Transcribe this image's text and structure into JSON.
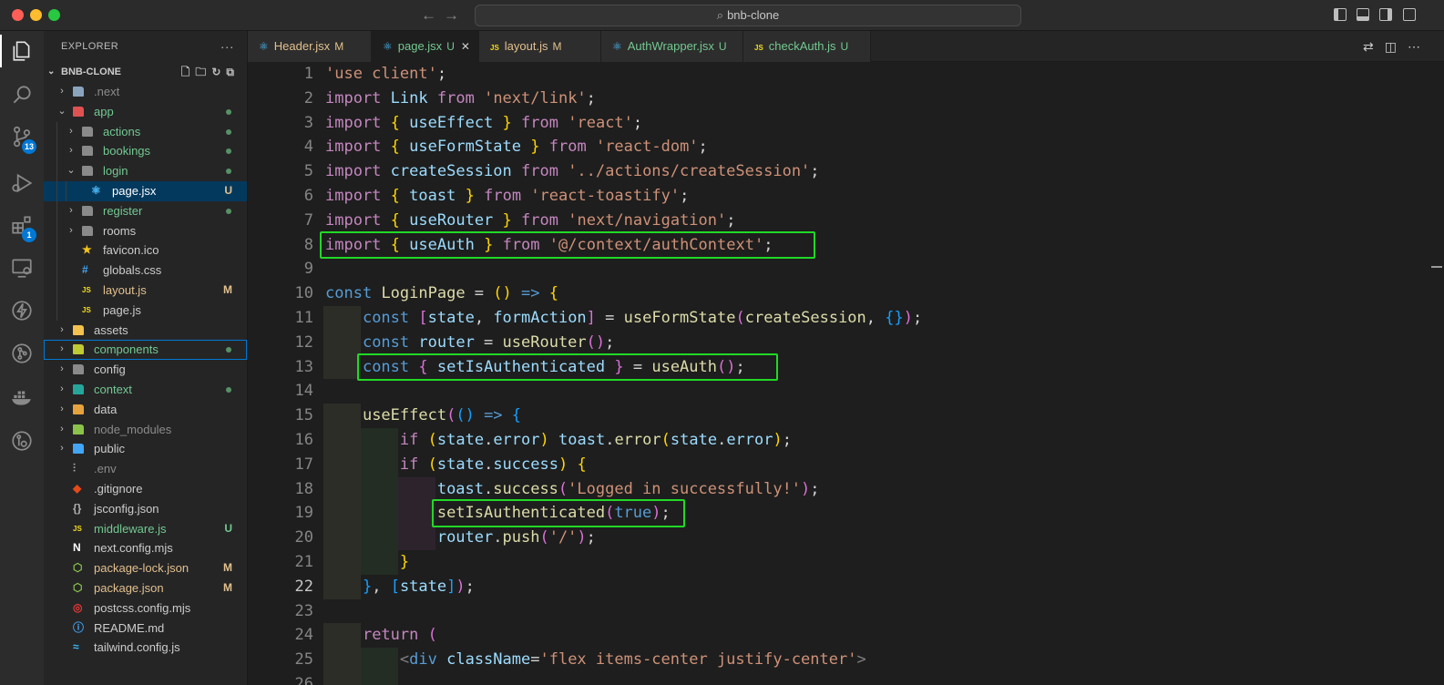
{
  "window": {
    "search_text": "bnb-clone"
  },
  "activity_bar": {
    "source_control_badge": "13",
    "extensions_badge": "1"
  },
  "explorer": {
    "title": "EXPLORER",
    "more": "···",
    "root": "BNB-CLONE",
    "items": [
      {
        "label": ".next",
        "kind": "folder",
        "depth": 1,
        "expanded": false,
        "color": "#8b8b8b",
        "icon_color": "#8aa4bd",
        "status": ""
      },
      {
        "label": "app",
        "kind": "folder",
        "depth": 1,
        "expanded": true,
        "color": "#73c991",
        "icon_color": "#e05252",
        "status": "dot"
      },
      {
        "label": "actions",
        "kind": "folder",
        "depth": 2,
        "expanded": false,
        "color": "#73c991",
        "icon_color": "#8a8a8a",
        "status": "dot"
      },
      {
        "label": "bookings",
        "kind": "folder",
        "depth": 2,
        "expanded": false,
        "color": "#73c991",
        "icon_color": "#8a8a8a",
        "status": "dot"
      },
      {
        "label": "login",
        "kind": "folder",
        "depth": 2,
        "expanded": true,
        "color": "#73c991",
        "icon_color": "#8a8a8a",
        "status": "dot"
      },
      {
        "label": "page.jsx",
        "kind": "file",
        "depth": 3,
        "color": "#ffffff",
        "icon_color": "#4fc1ff",
        "icon": "react-icon",
        "status": "U",
        "status_color": "#e2c08d",
        "selected": true
      },
      {
        "label": "register",
        "kind": "folder",
        "depth": 2,
        "expanded": false,
        "color": "#73c991",
        "icon_color": "#8a8a8a",
        "status": "dot"
      },
      {
        "label": "rooms",
        "kind": "folder",
        "depth": 2,
        "expanded": false,
        "color": "#cccccc",
        "icon_color": "#8a8a8a",
        "status": ""
      },
      {
        "label": "favicon.ico",
        "kind": "file",
        "depth": 2,
        "color": "#cccccc",
        "icon_color": "#f5c518",
        "icon": "star-icon",
        "status": ""
      },
      {
        "label": "globals.css",
        "kind": "file",
        "depth": 2,
        "color": "#cccccc",
        "icon_color": "#42a5f5",
        "icon": "css-icon",
        "status": ""
      },
      {
        "label": "layout.js",
        "kind": "file",
        "depth": 2,
        "color": "#e2c08d",
        "icon_color": "#f5de19",
        "icon": "js-icon",
        "status": "M",
        "status_color": "#e2c08d"
      },
      {
        "label": "page.js",
        "kind": "file",
        "depth": 2,
        "color": "#cccccc",
        "icon_color": "#f5de19",
        "icon": "js-icon",
        "status": ""
      },
      {
        "label": "assets",
        "kind": "folder",
        "depth": 1,
        "expanded": false,
        "color": "#cccccc",
        "icon_color": "#f2c14e",
        "status": ""
      },
      {
        "label": "components",
        "kind": "folder",
        "depth": 1,
        "expanded": false,
        "color": "#73c991",
        "icon_color": "#c0ca33",
        "status": "dot",
        "focused": true
      },
      {
        "label": "config",
        "kind": "folder",
        "depth": 1,
        "expanded": false,
        "color": "#cccccc",
        "icon_color": "#8a8a8a",
        "status": ""
      },
      {
        "label": "context",
        "kind": "folder",
        "depth": 1,
        "expanded": false,
        "color": "#73c991",
        "icon_color": "#26a69a",
        "status": "dot"
      },
      {
        "label": "data",
        "kind": "folder",
        "depth": 1,
        "expanded": false,
        "color": "#cccccc",
        "icon_color": "#e6a23c",
        "status": ""
      },
      {
        "label": "node_modules",
        "kind": "folder",
        "depth": 1,
        "expanded": false,
        "color": "#8b8b8b",
        "icon_color": "#8bc34a",
        "status": ""
      },
      {
        "label": "public",
        "kind": "folder",
        "depth": 1,
        "expanded": false,
        "color": "#cccccc",
        "icon_color": "#42a5f5",
        "status": ""
      },
      {
        "label": ".env",
        "kind": "file",
        "depth": 1,
        "color": "#8b8b8b",
        "icon_color": "#b0b0b0",
        "icon": "settings-icon",
        "status": ""
      },
      {
        "label": ".gitignore",
        "kind": "file",
        "depth": 1,
        "color": "#cccccc",
        "icon_color": "#e64a19",
        "icon": "git-icon",
        "status": ""
      },
      {
        "label": "jsconfig.json",
        "kind": "file",
        "depth": 1,
        "color": "#cccccc",
        "icon_color": "#b0b0b0",
        "icon": "json-icon",
        "status": ""
      },
      {
        "label": "middleware.js",
        "kind": "file",
        "depth": 1,
        "color": "#73c991",
        "icon_color": "#f5de19",
        "icon": "js-icon",
        "status": "U",
        "status_color": "#73c991"
      },
      {
        "label": "next.config.mjs",
        "kind": "file",
        "depth": 1,
        "color": "#cccccc",
        "icon_color": "#ffffff",
        "icon": "nextjs-icon",
        "status": ""
      },
      {
        "label": "package-lock.json",
        "kind": "file",
        "depth": 1,
        "color": "#e2c08d",
        "icon_color": "#8bc34a",
        "icon": "nodejs-icon",
        "status": "M",
        "status_color": "#e2c08d"
      },
      {
        "label": "package.json",
        "kind": "file",
        "depth": 1,
        "color": "#e2c08d",
        "icon_color": "#8bc34a",
        "icon": "nodejs-icon",
        "status": "M",
        "status_color": "#e2c08d"
      },
      {
        "label": "postcss.config.mjs",
        "kind": "file",
        "depth": 1,
        "color": "#cccccc",
        "icon_color": "#e53935",
        "icon": "postcss-icon",
        "status": ""
      },
      {
        "label": "README.md",
        "kind": "file",
        "depth": 1,
        "color": "#cccccc",
        "icon_color": "#42a5f5",
        "icon": "info-icon",
        "status": ""
      },
      {
        "label": "tailwind.config.js",
        "kind": "file",
        "depth": 1,
        "color": "#cccccc",
        "icon_color": "#38bdf8",
        "icon": "tailwind-icon",
        "status": ""
      }
    ]
  },
  "tabs": [
    {
      "label": "Header.jsx",
      "state": "M",
      "state_color": "#e2c08d",
      "label_color": "#e2c08d",
      "icon": "react-icon",
      "icon_glyph": "⚛",
      "icon_color": "#4fc1ff",
      "active": false
    },
    {
      "label": "page.jsx",
      "state": "U",
      "state_color": "#73c991",
      "label_color": "#73c991",
      "icon": "react-icon",
      "icon_glyph": "⚛",
      "icon_color": "#4fc1ff",
      "active": true,
      "close": "✕"
    },
    {
      "label": "layout.js",
      "state": "M",
      "state_color": "#e2c08d",
      "label_color": "#e2c08d",
      "icon": "js-icon",
      "icon_glyph": "JS",
      "icon_color": "#f5de19",
      "active": false
    },
    {
      "label": "AuthWrapper.jsx",
      "state": "U",
      "state_color": "#73c991",
      "label_color": "#73c991",
      "icon": "react-icon",
      "icon_glyph": "⚛",
      "icon_color": "#4fc1ff",
      "active": false
    },
    {
      "label": "checkAuth.js",
      "state": "U",
      "state_color": "#73c991",
      "label_color": "#73c991",
      "icon": "js-icon",
      "icon_glyph": "JS",
      "icon_color": "#f5de19",
      "active": false
    }
  ],
  "editor": {
    "current_line": 22,
    "line_numbers": [
      "1",
      "2",
      "3",
      "4",
      "5",
      "6",
      "7",
      "8",
      "9",
      "10",
      "11",
      "12",
      "13",
      "14",
      "15",
      "16",
      "17",
      "18",
      "19",
      "20",
      "21",
      "22",
      "23",
      "24",
      "25",
      "26"
    ],
    "lines": [
      [
        [
          "str",
          "'use client'"
        ],
        [
          "pl",
          ";"
        ]
      ],
      [
        [
          "kw",
          "import"
        ],
        [
          "pl",
          " "
        ],
        [
          "var",
          "Link"
        ],
        [
          "pl",
          " "
        ],
        [
          "kw",
          "from"
        ],
        [
          "pl",
          " "
        ],
        [
          "str",
          "'next/link'"
        ],
        [
          "pl",
          ";"
        ]
      ],
      [
        [
          "kw",
          "import"
        ],
        [
          "pl",
          " "
        ],
        [
          "br1",
          "{"
        ],
        [
          "pl",
          " "
        ],
        [
          "var",
          "useEffect"
        ],
        [
          "pl",
          " "
        ],
        [
          "br1",
          "}"
        ],
        [
          "pl",
          " "
        ],
        [
          "kw",
          "from"
        ],
        [
          "pl",
          " "
        ],
        [
          "str",
          "'react'"
        ],
        [
          "pl",
          ";"
        ]
      ],
      [
        [
          "kw",
          "import"
        ],
        [
          "pl",
          " "
        ],
        [
          "br1",
          "{"
        ],
        [
          "pl",
          " "
        ],
        [
          "var",
          "useFormState"
        ],
        [
          "pl",
          " "
        ],
        [
          "br1",
          "}"
        ],
        [
          "pl",
          " "
        ],
        [
          "kw",
          "from"
        ],
        [
          "pl",
          " "
        ],
        [
          "str",
          "'react-dom'"
        ],
        [
          "pl",
          ";"
        ]
      ],
      [
        [
          "kw",
          "import"
        ],
        [
          "pl",
          " "
        ],
        [
          "var",
          "createSession"
        ],
        [
          "pl",
          " "
        ],
        [
          "kw",
          "from"
        ],
        [
          "pl",
          " "
        ],
        [
          "str",
          "'../actions/createSession'"
        ],
        [
          "pl",
          ";"
        ]
      ],
      [
        [
          "kw",
          "import"
        ],
        [
          "pl",
          " "
        ],
        [
          "br1",
          "{"
        ],
        [
          "pl",
          " "
        ],
        [
          "var",
          "toast"
        ],
        [
          "pl",
          " "
        ],
        [
          "br1",
          "}"
        ],
        [
          "pl",
          " "
        ],
        [
          "kw",
          "from"
        ],
        [
          "pl",
          " "
        ],
        [
          "str",
          "'react-toastify'"
        ],
        [
          "pl",
          ";"
        ]
      ],
      [
        [
          "kw",
          "import"
        ],
        [
          "pl",
          " "
        ],
        [
          "br1",
          "{"
        ],
        [
          "pl",
          " "
        ],
        [
          "var",
          "useRouter"
        ],
        [
          "pl",
          " "
        ],
        [
          "br1",
          "}"
        ],
        [
          "pl",
          " "
        ],
        [
          "kw",
          "from"
        ],
        [
          "pl",
          " "
        ],
        [
          "str",
          "'next/navigation'"
        ],
        [
          "pl",
          ";"
        ]
      ],
      [
        [
          "kw",
          "import"
        ],
        [
          "pl",
          " "
        ],
        [
          "br1",
          "{"
        ],
        [
          "pl",
          " "
        ],
        [
          "var",
          "useAuth"
        ],
        [
          "pl",
          " "
        ],
        [
          "br1",
          "}"
        ],
        [
          "pl",
          " "
        ],
        [
          "kw",
          "from"
        ],
        [
          "pl",
          " "
        ],
        [
          "str",
          "'@/context/authContext'"
        ],
        [
          "pl",
          ";"
        ]
      ],
      [],
      [
        [
          "kb",
          "const"
        ],
        [
          "pl",
          " "
        ],
        [
          "fn",
          "LoginPage"
        ],
        [
          "pl",
          " = "
        ],
        [
          "br1",
          "()"
        ],
        [
          "pl",
          " "
        ],
        [
          "kb",
          "=>"
        ],
        [
          "pl",
          " "
        ],
        [
          "br1",
          "{"
        ]
      ],
      [
        [
          "pl",
          "    "
        ],
        [
          "kb",
          "const"
        ],
        [
          "pl",
          " "
        ],
        [
          "br2",
          "["
        ],
        [
          "var",
          "state"
        ],
        [
          "pl",
          ", "
        ],
        [
          "var",
          "formAction"
        ],
        [
          "br2",
          "]"
        ],
        [
          "pl",
          " = "
        ],
        [
          "fn",
          "useFormState"
        ],
        [
          "br2",
          "("
        ],
        [
          "fn",
          "createSession"
        ],
        [
          "pl",
          ", "
        ],
        [
          "br3",
          "{}"
        ],
        [
          "br2",
          ")"
        ],
        [
          "pl",
          ";"
        ]
      ],
      [
        [
          "pl",
          "    "
        ],
        [
          "kb",
          "const"
        ],
        [
          "pl",
          " "
        ],
        [
          "var",
          "router"
        ],
        [
          "pl",
          " = "
        ],
        [
          "fn",
          "useRouter"
        ],
        [
          "br2",
          "()"
        ],
        [
          "pl",
          ";"
        ]
      ],
      [
        [
          "pl",
          "    "
        ],
        [
          "kb",
          "const"
        ],
        [
          "pl",
          " "
        ],
        [
          "br2",
          "{"
        ],
        [
          "pl",
          " "
        ],
        [
          "var",
          "setIsAuthenticated"
        ],
        [
          "pl",
          " "
        ],
        [
          "br2",
          "}"
        ],
        [
          "pl",
          " = "
        ],
        [
          "fn",
          "useAuth"
        ],
        [
          "br2",
          "()"
        ],
        [
          "pl",
          ";"
        ]
      ],
      [],
      [
        [
          "pl",
          "    "
        ],
        [
          "fn",
          "useEffect"
        ],
        [
          "br2",
          "("
        ],
        [
          "br3",
          "()"
        ],
        [
          "pl",
          " "
        ],
        [
          "kb",
          "=>"
        ],
        [
          "pl",
          " "
        ],
        [
          "br3",
          "{"
        ]
      ],
      [
        [
          "pl",
          "        "
        ],
        [
          "kw",
          "if"
        ],
        [
          "pl",
          " "
        ],
        [
          "br1",
          "("
        ],
        [
          "var",
          "state"
        ],
        [
          "pl",
          "."
        ],
        [
          "var",
          "error"
        ],
        [
          "br1",
          ")"
        ],
        [
          "pl",
          " "
        ],
        [
          "var",
          "toast"
        ],
        [
          "pl",
          "."
        ],
        [
          "fn",
          "error"
        ],
        [
          "br1",
          "("
        ],
        [
          "var",
          "state"
        ],
        [
          "pl",
          "."
        ],
        [
          "var",
          "error"
        ],
        [
          "br1",
          ")"
        ],
        [
          "pl",
          ";"
        ]
      ],
      [
        [
          "pl",
          "        "
        ],
        [
          "kw",
          "if"
        ],
        [
          "pl",
          " "
        ],
        [
          "br1",
          "("
        ],
        [
          "var",
          "state"
        ],
        [
          "pl",
          "."
        ],
        [
          "var",
          "success"
        ],
        [
          "br1",
          ")"
        ],
        [
          "pl",
          " "
        ],
        [
          "br1",
          "{"
        ]
      ],
      [
        [
          "pl",
          "            "
        ],
        [
          "var",
          "toast"
        ],
        [
          "pl",
          "."
        ],
        [
          "fn",
          "success"
        ],
        [
          "br2",
          "("
        ],
        [
          "str",
          "'Logged in successfully!'"
        ],
        [
          "br2",
          ")"
        ],
        [
          "pl",
          ";"
        ]
      ],
      [
        [
          "pl",
          "            "
        ],
        [
          "fn",
          "setIsAuthenticated"
        ],
        [
          "br2",
          "("
        ],
        [
          "kb",
          "true"
        ],
        [
          "br2",
          ")"
        ],
        [
          "pl",
          ";"
        ]
      ],
      [
        [
          "pl",
          "            "
        ],
        [
          "var",
          "router"
        ],
        [
          "pl",
          "."
        ],
        [
          "fn",
          "push"
        ],
        [
          "br2",
          "("
        ],
        [
          "str",
          "'/'"
        ],
        [
          "br2",
          ")"
        ],
        [
          "pl",
          ";"
        ]
      ],
      [
        [
          "pl",
          "        "
        ],
        [
          "br1",
          "}"
        ]
      ],
      [
        [
          "pl",
          "    "
        ],
        [
          "br3",
          "}"
        ],
        [
          "pl",
          ", "
        ],
        [
          "br3",
          "["
        ],
        [
          "var",
          "state"
        ],
        [
          "br3",
          "]"
        ],
        [
          "br2",
          ")"
        ],
        [
          "pl",
          ";"
        ]
      ],
      [],
      [
        [
          "pl",
          "    "
        ],
        [
          "kw",
          "return"
        ],
        [
          "pl",
          " "
        ],
        [
          "br2",
          "("
        ]
      ],
      [
        [
          "pl",
          "        "
        ],
        [
          "tag",
          "<"
        ],
        [
          "tagn",
          "div"
        ],
        [
          "pl",
          " "
        ],
        [
          "attr",
          "className"
        ],
        [
          "pl",
          "="
        ],
        [
          "str",
          "'flex items-center justify-center'"
        ],
        [
          "tag",
          ">"
        ]
      ],
      []
    ]
  }
}
